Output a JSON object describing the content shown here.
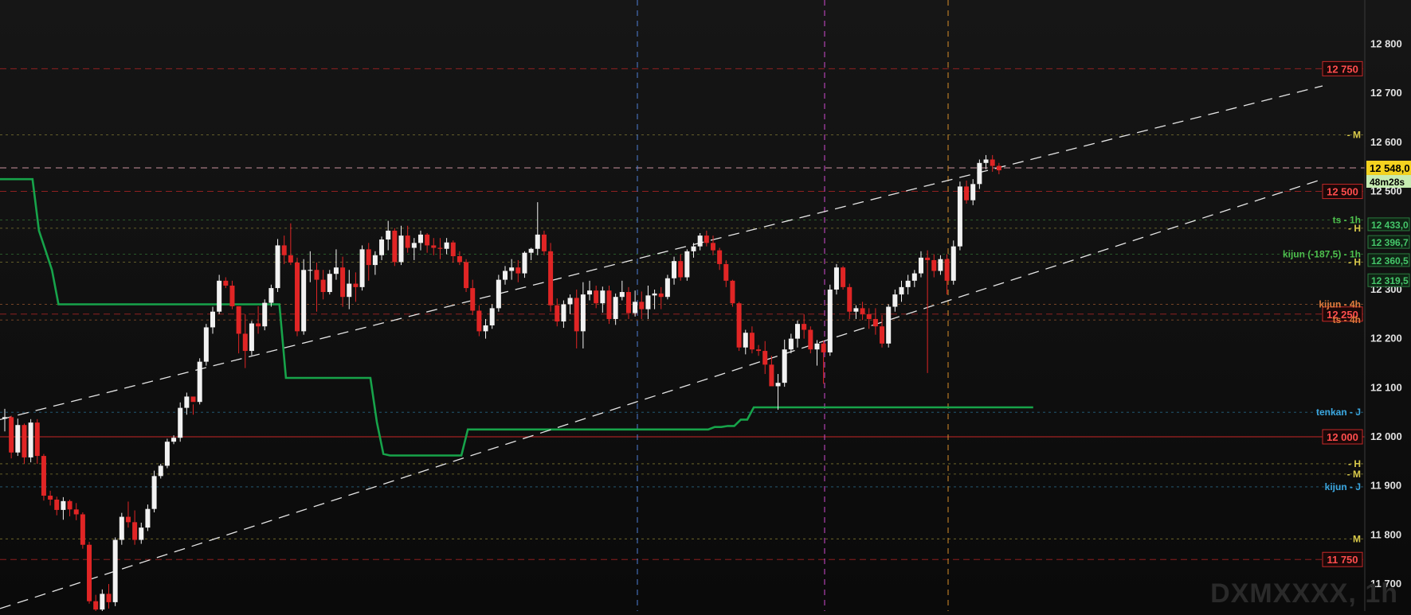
{
  "chart_data": {
    "type": "candlestick",
    "symbol_label": "DXMXXXX, 1h",
    "y_axis": {
      "ticks": [
        11700,
        11800,
        11900,
        12000,
        12100,
        12200,
        12300,
        12400,
        12500,
        12600,
        12700,
        12800
      ],
      "tick_labels": [
        "11 700",
        "11 800",
        "11 900",
        "12 000",
        "12 100",
        "12 200",
        "12 300",
        "12 400",
        "12 500",
        "12 600",
        "12 700",
        "12 800"
      ],
      "ylim": [
        11645,
        12890
      ]
    },
    "current_price": {
      "label": "12 548,0",
      "timer": "48m28s"
    },
    "price_boxes": [
      {
        "label": "12 750",
        "value": 12750,
        "color": "#e23b3b"
      },
      {
        "label": "12 500",
        "value": 12500,
        "color": "#e23b3b"
      },
      {
        "label": "12 250",
        "value": 12250,
        "color": "#e23b3b"
      },
      {
        "label": "12 000",
        "value": 12000,
        "color": "#e23b3b"
      },
      {
        "label": "11 750",
        "value": 11750,
        "color": "#e23b3b"
      }
    ],
    "indicator_boxes": [
      {
        "label": "12 433,0",
        "value": 12433
      },
      {
        "label": "12 396,7",
        "value": 12397
      },
      {
        "label": "12 360,5",
        "value": 12360
      },
      {
        "label": "12 319,5",
        "value": 12319
      }
    ],
    "level_labels": [
      {
        "label": "- M",
        "value": 12615,
        "color": "#d8c94a"
      },
      {
        "label": "ts - 1h",
        "value": 12442,
        "color": "#4dbf4d"
      },
      {
        "label": "- H",
        "value": 12425,
        "color": "#d8c94a"
      },
      {
        "label": "kijun (-187,5) - 1h",
        "value": 12372,
        "color": "#4dbf4d"
      },
      {
        "label": "- H",
        "value": 12356,
        "color": "#d8c94a"
      },
      {
        "label": "kijun - 4h",
        "value": 12270,
        "color": "#e07b3c"
      },
      {
        "label": "ts - 4h",
        "value": 12238,
        "color": "#e07b3c"
      },
      {
        "label": "tenkan - J",
        "value": 12050,
        "color": "#3ba7e0"
      },
      {
        "label": "- H",
        "value": 11945,
        "color": "#d8c94a"
      },
      {
        "label": "- M",
        "value": 11924,
        "color": "#d8c94a"
      },
      {
        "label": "kijun - J",
        "value": 11898,
        "color": "#3ba7e0"
      },
      {
        "label": "M",
        "value": 11792,
        "color": "#d8c94a"
      }
    ],
    "candles": [
      [
        12037,
        12057,
        12011,
        12040
      ],
      [
        12040,
        12043,
        11956,
        11968
      ],
      [
        11968,
        12037,
        11961,
        12024
      ],
      [
        12024,
        12027,
        11945,
        11958
      ],
      [
        11958,
        12036,
        11948,
        12029
      ],
      [
        12029,
        12036,
        11945,
        11961
      ],
      [
        11961,
        11965,
        11870,
        11880
      ],
      [
        11880,
        11890,
        11860,
        11872
      ],
      [
        11872,
        11878,
        11840,
        11851
      ],
      [
        11851,
        11877,
        11831,
        11869
      ],
      [
        11869,
        11872,
        11838,
        11852
      ],
      [
        11852,
        11865,
        11830,
        11842
      ],
      [
        11842,
        11846,
        11772,
        11780
      ],
      [
        11780,
        11786,
        11660,
        11665
      ],
      [
        11665,
        11678,
        11640,
        11648
      ],
      [
        11648,
        11689,
        11642,
        11680
      ],
      [
        11680,
        11700,
        11650,
        11663
      ],
      [
        11663,
        11795,
        11655,
        11790
      ],
      [
        11790,
        11845,
        11780,
        11837
      ],
      [
        11837,
        11868,
        11815,
        11826
      ],
      [
        11826,
        11850,
        11780,
        11790
      ],
      [
        11790,
        11825,
        11782,
        11815
      ],
      [
        11815,
        11862,
        11808,
        11853
      ],
      [
        11853,
        11931,
        11846,
        11920
      ],
      [
        11920,
        11945,
        11915,
        11941
      ],
      [
        11941,
        11996,
        11936,
        11990
      ],
      [
        11990,
        12003,
        11985,
        11998
      ],
      [
        11998,
        12070,
        11990,
        12059
      ],
      [
        12059,
        12090,
        12045,
        12082
      ],
      [
        12082,
        12066,
        12045,
        12071
      ],
      [
        12071,
        12160,
        12066,
        12153
      ],
      [
        12153,
        12230,
        12145,
        12223
      ],
      [
        12223,
        12265,
        12210,
        12255
      ],
      [
        12255,
        12330,
        12250,
        12318
      ],
      [
        12318,
        12325,
        12303,
        12308
      ],
      [
        12308,
        12318,
        12260,
        12266
      ],
      [
        12266,
        12266,
        12170,
        12210
      ],
      [
        12210,
        12250,
        12140,
        12175
      ],
      [
        12175,
        12236,
        12166,
        12231
      ],
      [
        12231,
        12266,
        12210,
        12225
      ],
      [
        12225,
        12280,
        12217,
        12273
      ],
      [
        12273,
        12310,
        12265,
        12303
      ],
      [
        12303,
        12403,
        12295,
        12390
      ],
      [
        12390,
        12410,
        12352,
        12370
      ],
      [
        12370,
        12435,
        12350,
        12355
      ],
      [
        12355,
        12365,
        12205,
        12215
      ],
      [
        12215,
        12362,
        12208,
        12340
      ],
      [
        12340,
        12378,
        12315,
        12340
      ],
      [
        12340,
        12355,
        12255,
        12320
      ],
      [
        12320,
        12340,
        12280,
        12295
      ],
      [
        12295,
        12340,
        12290,
        12332
      ],
      [
        12332,
        12382,
        12320,
        12345
      ],
      [
        12345,
        12367,
        12265,
        12285
      ],
      [
        12285,
        12340,
        12260,
        12312
      ],
      [
        12312,
        12335,
        12275,
        12305
      ],
      [
        12305,
        12390,
        12298,
        12382
      ],
      [
        12382,
        12395,
        12318,
        12350
      ],
      [
        12350,
        12378,
        12330,
        12370
      ],
      [
        12370,
        12408,
        12360,
        12402
      ],
      [
        12402,
        12440,
        12380,
        12420
      ],
      [
        12420,
        12425,
        12348,
        12356
      ],
      [
        12356,
        12430,
        12350,
        12410
      ],
      [
        12410,
        12430,
        12375,
        12385
      ],
      [
        12385,
        12405,
        12360,
        12395
      ],
      [
        12395,
        12420,
        12380,
        12412
      ],
      [
        12412,
        12415,
        12375,
        12390
      ],
      [
        12390,
        12405,
        12370,
        12385
      ],
      [
        12385,
        12405,
        12362,
        12383
      ],
      [
        12383,
        12405,
        12372,
        12396
      ],
      [
        12396,
        12400,
        12355,
        12368
      ],
      [
        12368,
        12378,
        12350,
        12356
      ],
      [
        12356,
        12362,
        12295,
        12303
      ],
      [
        12303,
        12320,
        12248,
        12257
      ],
      [
        12257,
        12268,
        12205,
        12215
      ],
      [
        12215,
        12240,
        12200,
        12227
      ],
      [
        12227,
        12270,
        12220,
        12262
      ],
      [
        12262,
        12330,
        12255,
        12320
      ],
      [
        12320,
        12348,
        12310,
        12338
      ],
      [
        12338,
        12362,
        12320,
        12345
      ],
      [
        12345,
        12360,
        12315,
        12333
      ],
      [
        12333,
        12378,
        12324,
        12375
      ],
      [
        12375,
        12385,
        12360,
        12383
      ],
      [
        12383,
        12478,
        12370,
        12412
      ],
      [
        12412,
        12420,
        12370,
        12378
      ],
      [
        12378,
        12395,
        12255,
        12268
      ],
      [
        12268,
        12282,
        12225,
        12235
      ],
      [
        12235,
        12278,
        12222,
        12270
      ],
      [
        12270,
        12290,
        12250,
        12283
      ],
      [
        12283,
        12300,
        12180,
        12215
      ],
      [
        12215,
        12315,
        12180,
        12290
      ],
      [
        12290,
        12318,
        12278,
        12298
      ],
      [
        12298,
        12308,
        12262,
        12272
      ],
      [
        12272,
        12306,
        12253,
        12298
      ],
      [
        12298,
        12308,
        12230,
        12240
      ],
      [
        12240,
        12292,
        12228,
        12285
      ],
      [
        12285,
        12318,
        12278,
        12295
      ],
      [
        12295,
        12305,
        12240,
        12252
      ],
      [
        12252,
        12298,
        12245,
        12275
      ],
      [
        12275,
        12296,
        12240,
        12260
      ],
      [
        12260,
        12308,
        12240,
        12288
      ],
      [
        12288,
        12300,
        12260,
        12292
      ],
      [
        12292,
        12305,
        12260,
        12285
      ],
      [
        12285,
        12330,
        12280,
        12323
      ],
      [
        12323,
        12367,
        12310,
        12358
      ],
      [
        12358,
        12372,
        12318,
        12325
      ],
      [
        12325,
        12382,
        12318,
        12378
      ],
      [
        12378,
        12395,
        12365,
        12388
      ],
      [
        12388,
        12415,
        12380,
        12410
      ],
      [
        12410,
        12420,
        12388,
        12395
      ],
      [
        12395,
        12410,
        12370,
        12380
      ],
      [
        12380,
        12385,
        12340,
        12352
      ],
      [
        12352,
        12360,
        12305,
        12318
      ],
      [
        12318,
        12320,
        12265,
        12272
      ],
      [
        12272,
        12275,
        12175,
        12182
      ],
      [
        12182,
        12218,
        12168,
        12212
      ],
      [
        12212,
        12225,
        12170,
        12178
      ],
      [
        12178,
        12187,
        12165,
        12175
      ],
      [
        12175,
        12195,
        12128,
        12147
      ],
      [
        12147,
        12165,
        12115,
        12103
      ],
      [
        12103,
        12128,
        12055,
        12110
      ],
      [
        12110,
        12198,
        12102,
        12178
      ],
      [
        12178,
        12210,
        12170,
        12200
      ],
      [
        12200,
        12237,
        12182,
        12230
      ],
      [
        12230,
        12250,
        12200,
        12218
      ],
      [
        12218,
        12225,
        12170,
        12178
      ],
      [
        12178,
        12197,
        12145,
        12190
      ],
      [
        12190,
        12196,
        12108,
        12172
      ],
      [
        12172,
        12310,
        12165,
        12300
      ],
      [
        12300,
        12352,
        12290,
        12345
      ],
      [
        12345,
        12348,
        12300,
        12305
      ],
      [
        12305,
        12312,
        12240,
        12255
      ],
      [
        12255,
        12268,
        12240,
        12262
      ],
      [
        12262,
        12275,
        12238,
        12250
      ],
      [
        12250,
        12262,
        12220,
        12240
      ],
      [
        12240,
        12262,
        12208,
        12225
      ],
      [
        12225,
        12248,
        12182,
        12190
      ],
      [
        12190,
        12270,
        12182,
        12265
      ],
      [
        12265,
        12300,
        12255,
        12290
      ],
      [
        12290,
        12318,
        12275,
        12305
      ],
      [
        12305,
        12330,
        12290,
        12318
      ],
      [
        12318,
        12340,
        12305,
        12333
      ],
      [
        12333,
        12378,
        12325,
        12365
      ],
      [
        12365,
        12380,
        12130,
        12360
      ],
      [
        12360,
        12372,
        12325,
        12338
      ],
      [
        12338,
        12370,
        12330,
        12362
      ],
      [
        12362,
        12372,
        12290,
        12318
      ],
      [
        12318,
        12400,
        12310,
        12388
      ],
      [
        12388,
        12520,
        12380,
        12510
      ],
      [
        12510,
        12522,
        12475,
        12482
      ],
      [
        12482,
        12525,
        12472,
        12515
      ],
      [
        12515,
        12565,
        12505,
        12558
      ],
      [
        12558,
        12574,
        12545,
        12565
      ],
      [
        12565,
        12574,
        12540,
        12552
      ],
      [
        12552,
        12558,
        12535,
        12543
      ]
    ],
    "ichimoku": {
      "kijun_1h": [
        12525,
        12525,
        12525,
        12525,
        12525,
        12525,
        12420,
        12380,
        12340,
        12270,
        12270,
        12270,
        12270,
        12270,
        12270,
        12270,
        12270,
        12270,
        12270,
        12270,
        12270,
        12270,
        12270,
        12270,
        12270,
        12270,
        12270,
        12270,
        12270,
        12270,
        12270,
        12270,
        12270,
        12270,
        12270,
        12270,
        12270,
        12270,
        12270,
        12270,
        12270,
        12270,
        12270,
        12270,
        12120,
        12120,
        12120,
        12120,
        12120,
        12120,
        12120,
        12120,
        12120,
        12120,
        12120,
        12120,
        12120,
        12120,
        12030,
        11965,
        11962,
        11962,
        11962,
        11962,
        11962,
        11962,
        11962,
        11962,
        11962,
        11962,
        11962,
        11962,
        12015,
        12015,
        12015,
        12015,
        12015,
        12015,
        12015,
        12015,
        12015,
        12015,
        12015,
        12015,
        12015,
        12015,
        12015,
        12015,
        12015,
        12015,
        12015,
        12015,
        12015,
        12015,
        12015,
        12015,
        12015,
        12015,
        12015,
        12015,
        12015,
        12015,
        12015,
        12015,
        12015,
        12015,
        12015,
        12015,
        12015,
        12015,
        12020,
        12020,
        12022,
        12022,
        12035,
        12035,
        12060,
        12060,
        12060,
        12060,
        12060,
        12060,
        12060,
        12060,
        12060,
        12060,
        12060,
        12060,
        12060,
        12060,
        12060,
        12060,
        12060,
        12060,
        12060,
        12060,
        12060,
        12060,
        12060,
        12060,
        12060,
        12060,
        12060,
        12060,
        12060,
        12060,
        12060,
        12060,
        12060,
        12060,
        12060,
        12060,
        12060,
        12060,
        12060,
        12060,
        12060,
        12060,
        12060,
        12060
      ],
      "note": "levels in price units"
    }
  }
}
